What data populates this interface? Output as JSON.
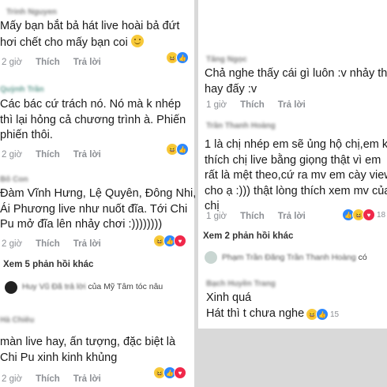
{
  "left": {
    "c1": {
      "name": "Trinh Nguyen",
      "lines": [
        "Mấy bạn bắt bả hát live hoài bả đứt",
        "hơi chết cho mấy bạn coi"
      ],
      "time": "2 giờ",
      "like": "Thích",
      "reply": "Trả lời"
    },
    "c2": {
      "name": "Quỳnh Trần",
      "lines": [
        "Các bác cứ trách nó. Nó mà k nhép",
        "thì lại hỏng cả chương trình à. Phiến",
        "phiến thôi."
      ],
      "time": "2 giờ",
      "like": "Thích",
      "reply": "Trả lời"
    },
    "c3": {
      "name": "Bô Con",
      "lines": [
        "Đàm Vĩnh Hưng, Lệ Quyên, Đông Nhi,",
        "Ái Phương live như nuốt đĩa. Tới Chi",
        "Pu mở đĩa lên nhảy chơi :))))))))"
      ],
      "time": "2 giờ",
      "like": "Thích",
      "reply": "Trả lời"
    },
    "more": "Xem 5 phản hồi khác",
    "reply_preview": {
      "blurred": "Huy Vũ Đã trả lời",
      "suffix": "của Mỹ Tâm tóc nâu"
    },
    "c4": {
      "name": "Hà Chiêu",
      "lines": [
        "màn live hay, ấn tượng, đặc biệt là",
        "Chi Pu xinh kinh khủng"
      ],
      "time": "2 giờ",
      "like": "Thích",
      "reply": "Trả lời"
    }
  },
  "right": {
    "c1": {
      "name": "Tăng Ngọc",
      "lines": [
        "Chả nghe thấy cái gì luôn :v nhảy thì",
        "hay đấy :v"
      ],
      "time": "1 giờ",
      "like": "Thích",
      "reply": "Trả lời"
    },
    "c2": {
      "name": "Trần Thanh Hoàng",
      "lines": [
        "1 là chị nhép em sẽ ủng hộ chị,em k",
        "thích chị live bằng giọng thật vì em",
        "rất là mệt theo,cứ ra mv em cày view",
        "cho ạ :))) thật lòng thích xem mv của",
        "chị"
      ],
      "time": "1 giờ",
      "like": "Thích",
      "reply": "Trả lời",
      "reactions": "18"
    },
    "more": "Xem 2 phản hồi khác",
    "reply_preview": {
      "blurred": "Phạm Trần Đăng Trần Thanh Hoàng",
      "suffix": "có"
    },
    "c3": {
      "name": "Bạch Huyền Trang",
      "lines": [
        "Xinh quá",
        "Hát thì t chưa nghe"
      ],
      "reactions": "15"
    }
  }
}
